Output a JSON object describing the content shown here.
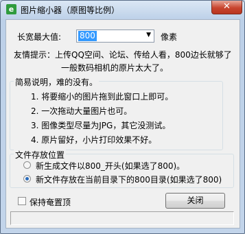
{
  "window": {
    "title": "图片缩小器（原图等比例）",
    "app_icon_glyph": "e"
  },
  "close_glyph": "✕",
  "size_row": {
    "label": "长宽最大值:",
    "value": "800",
    "suffix": "像素"
  },
  "tip": {
    "line1": "友情提示：上传QQ空间、论坛、传给人看，800边长就够了",
    "line2": "一般数码相机的原片太大了。"
  },
  "instructions": {
    "legend": "简易说明，难的没有。",
    "items": [
      "1. 将要缩小的图片拖到此窗口上即可。",
      "2. 一次拖动大量图片也可。",
      "3. 图像类型尽量为JPG，其它没测试。",
      "4. 原片留好，小片打印效果不好。"
    ]
  },
  "save_location": {
    "legend": "文件存放位置",
    "option1": "新生成文件以800_开头(如果选了800)。",
    "option2": "新文件存放在当前目录下的800目录(如果选了800)",
    "selected": 2
  },
  "keep_on_top": {
    "label": "保持奄置顶",
    "checked": false
  },
  "close_button": {
    "label": "关闭"
  },
  "colors": {
    "selection": "#3399ff",
    "radio_dot": "#2a6cbc",
    "close": "#c8452f"
  }
}
